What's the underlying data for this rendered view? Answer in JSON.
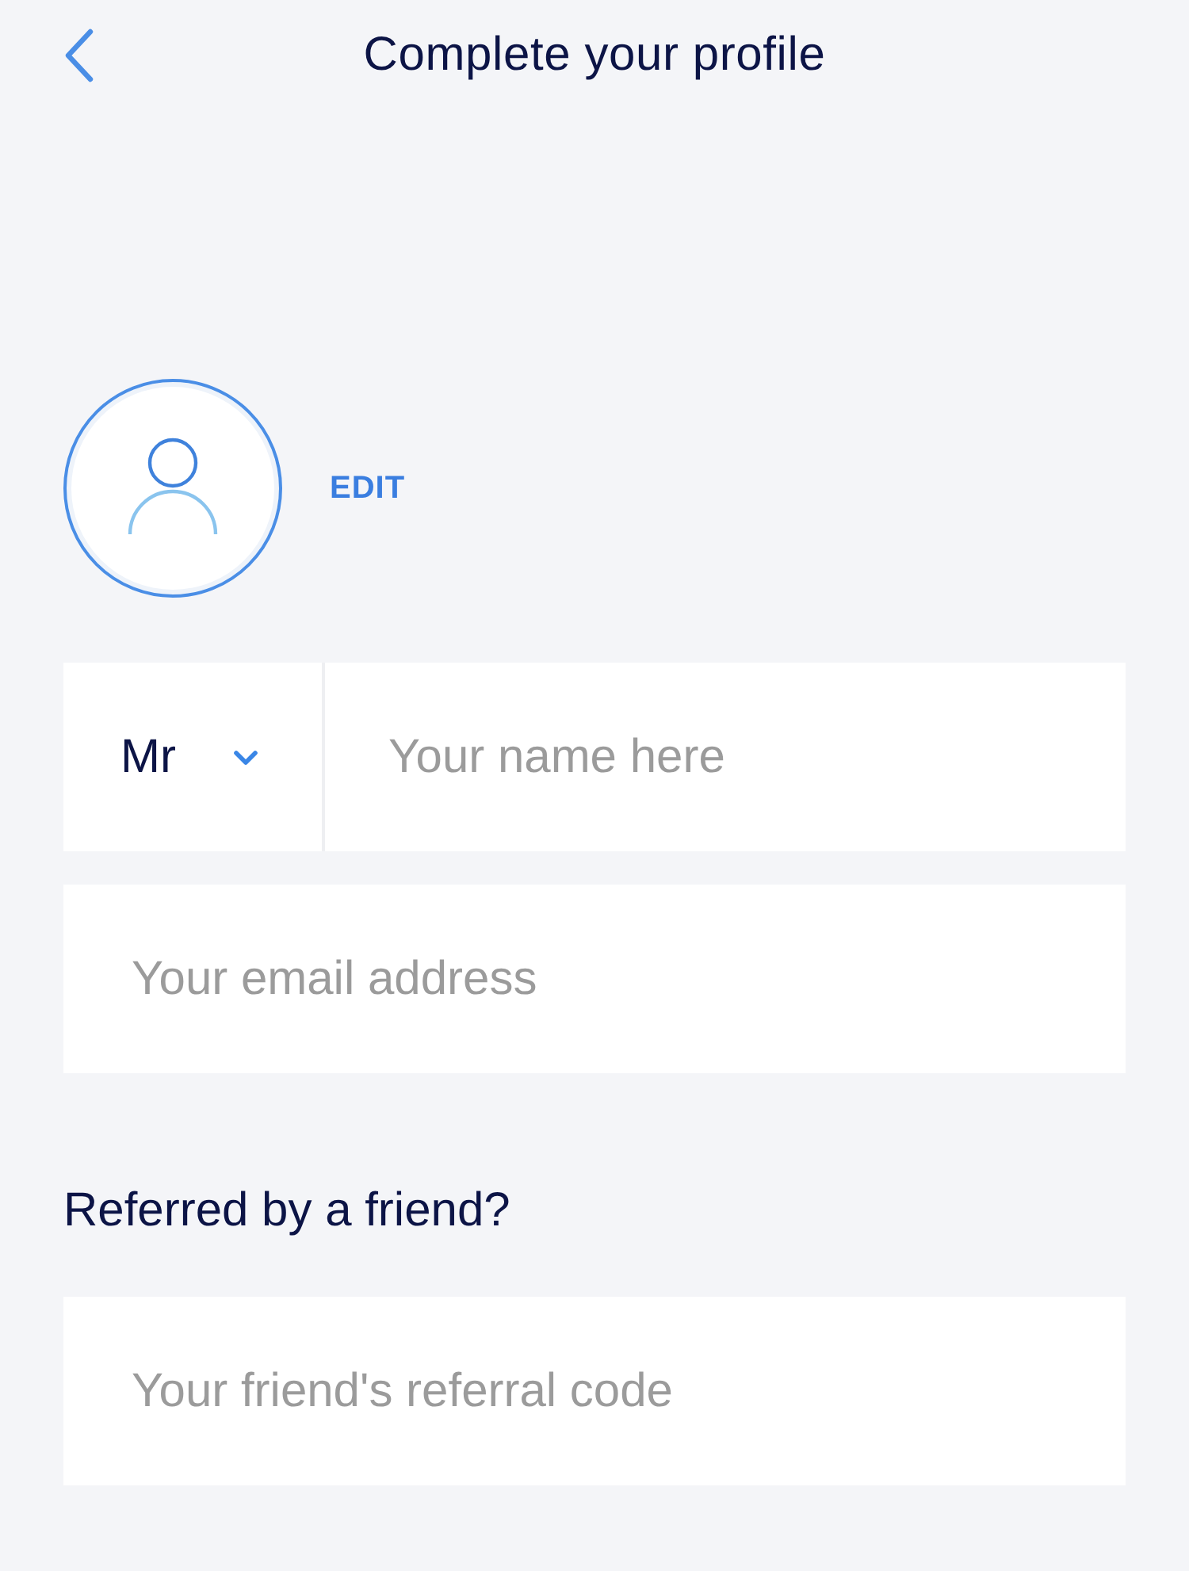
{
  "header": {
    "title": "Complete your profile"
  },
  "avatar": {
    "action": "EDIT"
  },
  "name_row": {
    "salutation": {
      "value": "Mr"
    },
    "name_field": {
      "placeholder": "Your name here"
    }
  },
  "email_field": {
    "placeholder": "Your email address"
  },
  "referral": {
    "heading": "Referred by a friend?",
    "code_field": {
      "placeholder": "Your friend's referral code"
    }
  }
}
